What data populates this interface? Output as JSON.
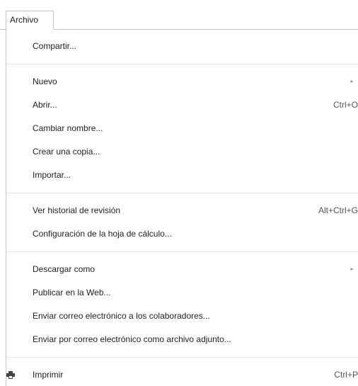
{
  "menubar": {
    "file_tab_label": "Archivo"
  },
  "menu": {
    "share": "Compartir...",
    "new": "Nuevo",
    "open": {
      "label": "Abrir...",
      "shortcut": "Ctrl+O"
    },
    "rename": "Cambiar nombre...",
    "make_copy": "Crear una copia...",
    "import": "Importar...",
    "revision_history": {
      "label": "Ver historial de revisión",
      "shortcut": "Alt+Ctrl+G"
    },
    "spreadsheet_settings": "Configuración de la hoja de cálculo...",
    "download_as": "Descargar como",
    "publish_web": "Publicar en la Web...",
    "email_collaborators": "Enviar correo electrónico a los colaboradores...",
    "email_attachment": "Enviar por correo electrónico como archivo adjunto...",
    "print": {
      "label": "Imprimir",
      "shortcut": "Ctrl+P",
      "icon": "printer-icon"
    },
    "submenu_arrow": "►"
  }
}
